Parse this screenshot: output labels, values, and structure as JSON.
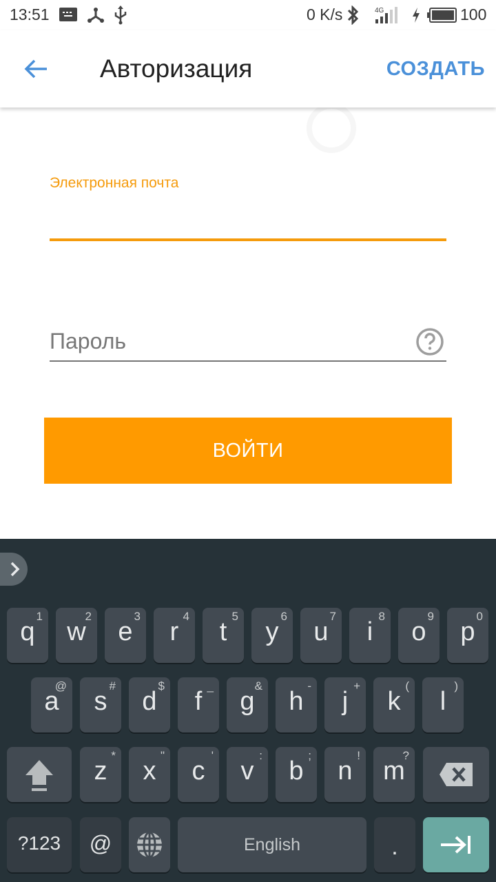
{
  "status_bar": {
    "time": "13:51",
    "left_icons": [
      "keyboard-icon",
      "share-network-icon",
      "usb-icon"
    ],
    "network_speed": "0 K/s",
    "network_type": "4G",
    "battery_level": "100",
    "right_icons": [
      "bluetooth-icon",
      "signal-icon",
      "charging-icon",
      "battery-icon"
    ]
  },
  "app_bar": {
    "title": "Авторизация",
    "action_label": "СОЗДАТЬ",
    "back_icon": "arrow-left-icon"
  },
  "form": {
    "email": {
      "label": "Электронная почта",
      "value": ""
    },
    "password": {
      "placeholder": "Пароль",
      "value": "",
      "help_icon": "help-circle-icon"
    },
    "submit_label": "ВОЙТИ"
  },
  "colors": {
    "accent": "#ff9a00",
    "link": "#4a90d9",
    "keyboard_bg": "#263238",
    "key_bg": "#424a52",
    "enter_key": "#6aa9a2"
  },
  "keyboard": {
    "row1": [
      {
        "key": "q",
        "hint": "1"
      },
      {
        "key": "w",
        "hint": "2"
      },
      {
        "key": "e",
        "hint": "3"
      },
      {
        "key": "r",
        "hint": "4"
      },
      {
        "key": "t",
        "hint": "5"
      },
      {
        "key": "y",
        "hint": "6"
      },
      {
        "key": "u",
        "hint": "7"
      },
      {
        "key": "i",
        "hint": "8"
      },
      {
        "key": "o",
        "hint": "9"
      },
      {
        "key": "p",
        "hint": "0"
      }
    ],
    "row2": [
      {
        "key": "a",
        "hint": "@"
      },
      {
        "key": "s",
        "hint": "#"
      },
      {
        "key": "d",
        "hint": "$"
      },
      {
        "key": "f",
        "hint": "_"
      },
      {
        "key": "g",
        "hint": "&"
      },
      {
        "key": "h",
        "hint": "-"
      },
      {
        "key": "j",
        "hint": "+"
      },
      {
        "key": "k",
        "hint": "("
      },
      {
        "key": "l",
        "hint": ")"
      }
    ],
    "row3": [
      {
        "key": "z",
        "hint": "*"
      },
      {
        "key": "x",
        "hint": "\""
      },
      {
        "key": "c",
        "hint": "'"
      },
      {
        "key": "v",
        "hint": ":"
      },
      {
        "key": "b",
        "hint": ";"
      },
      {
        "key": "n",
        "hint": "!"
      },
      {
        "key": "m",
        "hint": "?"
      }
    ],
    "symbols_label": "?123",
    "at_label": "@",
    "space_label": "English",
    "period_label": "."
  }
}
